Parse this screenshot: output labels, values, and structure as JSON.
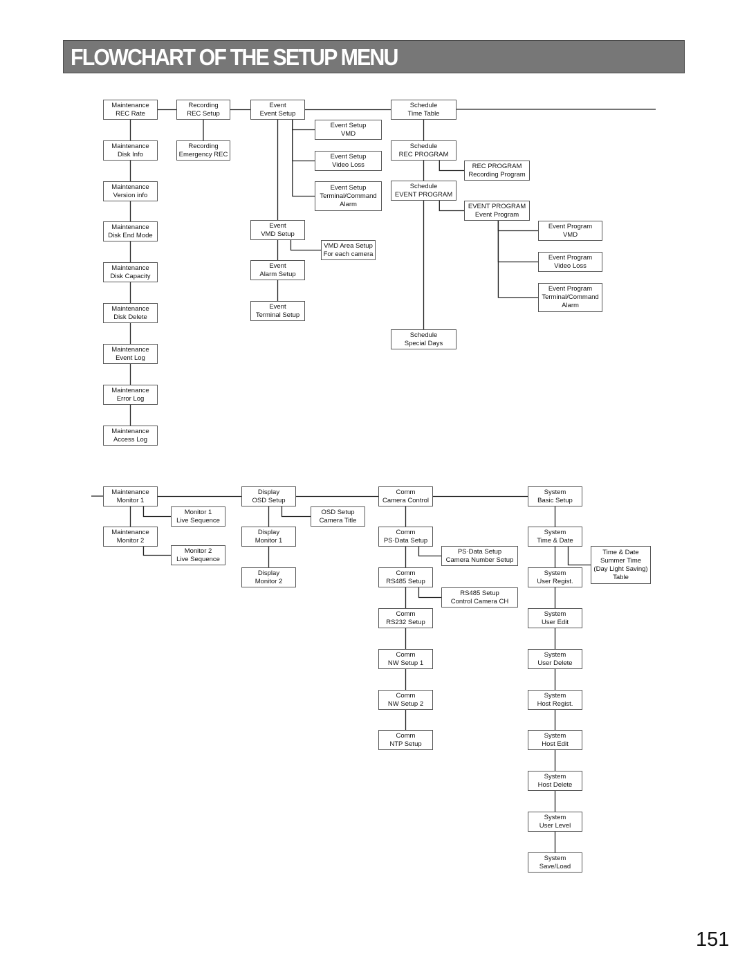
{
  "page": {
    "title": "FLOWCHART OF THE SETUP MENU",
    "page_number": "151"
  },
  "nodes": {
    "maint_rec_rate": [
      "Maintenance",
      "REC Rate"
    ],
    "maint_disk_info": [
      "Maintenance",
      "Disk Info"
    ],
    "maint_version": [
      "Maintenance",
      "Version info"
    ],
    "maint_disk_end": [
      "Maintenance",
      "Disk End Mode"
    ],
    "maint_disk_cap": [
      "Maintenance",
      "Disk Capacity"
    ],
    "maint_disk_del": [
      "Maintenance",
      "Disk Delete"
    ],
    "maint_event_log": [
      "Maintenance",
      "Event Log"
    ],
    "maint_error_log": [
      "Maintenance",
      "Error Log"
    ],
    "maint_access_log": [
      "Maintenance",
      "Access Log"
    ],
    "rec_setup": [
      "Recording",
      "REC Setup"
    ],
    "rec_emergency": [
      "Recording",
      "Emergency REC"
    ],
    "event_setup": [
      "Event",
      "Event Setup"
    ],
    "event_setup_vmd": [
      "Event Setup",
      "VMD"
    ],
    "event_setup_vloss": [
      "Event Setup",
      "Video Loss"
    ],
    "event_setup_term": [
      "Event Setup",
      "Terminal/Command",
      "Alarm"
    ],
    "event_vmd_setup": [
      "Event",
      "VMD Setup"
    ],
    "vmd_area": [
      "VMD Area Setup",
      "For each camera"
    ],
    "event_alarm": [
      "Event",
      "Alarm Setup"
    ],
    "event_terminal": [
      "Event",
      "Terminal Setup"
    ],
    "sched_time_table": [
      "Schedule",
      "Time Table"
    ],
    "sched_rec_prog": [
      "Schedule",
      "REC PROGRAM"
    ],
    "rec_prog_recording": [
      "REC PROGRAM",
      "Recording Program"
    ],
    "sched_event_prog": [
      "Schedule",
      "EVENT PROGRAM"
    ],
    "event_prog_event": [
      "EVENT PROGRAM",
      "Event Program"
    ],
    "evprog_vmd": [
      "Event Program",
      "VMD"
    ],
    "evprog_vloss": [
      "Event Program",
      "Video Loss"
    ],
    "evprog_term": [
      "Event Program",
      "Terminal/Command",
      "Alarm"
    ],
    "sched_special": [
      "Schedule",
      "Special Days"
    ],
    "maint_mon1": [
      "Maintenance",
      "Monitor 1"
    ],
    "mon1_live": [
      "Monitor 1",
      "Live Sequence"
    ],
    "maint_mon2": [
      "Maintenance",
      "Monitor 2"
    ],
    "mon2_live": [
      "Monitor 2",
      "Live Sequence"
    ],
    "disp_osd": [
      "Display",
      "OSD Setup"
    ],
    "osd_cam_title": [
      "OSD Setup",
      "Camera Title"
    ],
    "disp_mon1": [
      "Display",
      "Monitor 1"
    ],
    "disp_mon2": [
      "Display",
      "Monitor 2"
    ],
    "comm_cam_ctrl": [
      "Comm",
      "Camera Control"
    ],
    "comm_psdata": [
      "Comm",
      "PS·Data Setup"
    ],
    "psdata_cam_num": [
      "PS·Data Setup",
      "Camera Number Setup"
    ],
    "comm_rs485": [
      "Comm",
      "RS485 Setup"
    ],
    "rs485_ctrl_ch": [
      "RS485 Setup",
      "Control Camera CH"
    ],
    "comm_rs232": [
      "Comm",
      "RS232 Setup"
    ],
    "comm_nw1": [
      "Comm",
      "NW Setup 1"
    ],
    "comm_nw2": [
      "Comm",
      "NW Setup 2"
    ],
    "comm_ntp": [
      "Comm",
      "NTP Setup"
    ],
    "sys_basic": [
      "System",
      "Basic Setup"
    ],
    "sys_time_date": [
      "System",
      "Time & Date"
    ],
    "time_summer": [
      "Time & Date",
      "Summer Time",
      "(Day Light Saving)",
      "Table"
    ],
    "sys_user_regist": [
      "System",
      "User Regist."
    ],
    "sys_user_edit": [
      "System",
      "User Edit"
    ],
    "sys_user_delete": [
      "System",
      "User Delete"
    ],
    "sys_host_regist": [
      "System",
      "Host Regist."
    ],
    "sys_host_edit": [
      "System",
      "Host Edit"
    ],
    "sys_host_delete": [
      "System",
      "Host Delete"
    ],
    "sys_user_level": [
      "System",
      "User Level"
    ],
    "sys_save_load": [
      "System",
      "Save/Load"
    ]
  },
  "edges": [
    [
      "maint_rec_rate",
      "rec_setup"
    ],
    [
      "rec_setup",
      "event_setup"
    ],
    [
      "event_setup",
      "sched_time_table"
    ],
    [
      "maint_rec_rate",
      "maint_disk_info"
    ],
    [
      "maint_disk_info",
      "maint_version"
    ],
    [
      "maint_version",
      "maint_disk_end"
    ],
    [
      "maint_disk_end",
      "maint_disk_cap"
    ],
    [
      "maint_disk_cap",
      "maint_disk_del"
    ],
    [
      "maint_disk_del",
      "maint_event_log"
    ],
    [
      "maint_event_log",
      "maint_error_log"
    ],
    [
      "maint_error_log",
      "maint_access_log"
    ],
    [
      "rec_setup",
      "rec_emergency"
    ],
    [
      "event_setup",
      "event_setup_vmd"
    ],
    [
      "event_setup",
      "event_setup_vloss"
    ],
    [
      "event_setup",
      "event_setup_term"
    ],
    [
      "event_setup",
      "event_vmd_setup"
    ],
    [
      "event_vmd_setup",
      "vmd_area"
    ],
    [
      "event_vmd_setup",
      "event_alarm"
    ],
    [
      "event_alarm",
      "event_terminal"
    ],
    [
      "sched_time_table",
      "sched_rec_prog"
    ],
    [
      "sched_rec_prog",
      "rec_prog_recording"
    ],
    [
      "sched_rec_prog",
      "sched_event_prog"
    ],
    [
      "sched_event_prog",
      "event_prog_event"
    ],
    [
      "event_prog_event",
      "evprog_vmd"
    ],
    [
      "event_prog_event",
      "evprog_vloss"
    ],
    [
      "event_prog_event",
      "evprog_term"
    ],
    [
      "sched_event_prog",
      "sched_special"
    ],
    [
      "maint_mon1",
      "disp_osd"
    ],
    [
      "disp_osd",
      "comm_cam_ctrl"
    ],
    [
      "comm_cam_ctrl",
      "sys_basic"
    ],
    [
      "maint_mon1",
      "mon1_live"
    ],
    [
      "maint_mon1",
      "maint_mon2"
    ],
    [
      "maint_mon2",
      "mon2_live"
    ],
    [
      "disp_osd",
      "osd_cam_title"
    ],
    [
      "disp_osd",
      "disp_mon1"
    ],
    [
      "disp_mon1",
      "disp_mon2"
    ],
    [
      "comm_cam_ctrl",
      "comm_psdata"
    ],
    [
      "comm_psdata",
      "psdata_cam_num"
    ],
    [
      "comm_psdata",
      "comm_rs485"
    ],
    [
      "comm_rs485",
      "rs485_ctrl_ch"
    ],
    [
      "comm_rs485",
      "comm_rs232"
    ],
    [
      "comm_rs232",
      "comm_nw1"
    ],
    [
      "comm_nw1",
      "comm_nw2"
    ],
    [
      "comm_nw2",
      "comm_ntp"
    ],
    [
      "sys_basic",
      "sys_time_date"
    ],
    [
      "sys_time_date",
      "time_summer"
    ],
    [
      "sys_time_date",
      "sys_user_regist"
    ],
    [
      "sys_user_regist",
      "sys_user_edit"
    ],
    [
      "sys_user_edit",
      "sys_user_delete"
    ],
    [
      "sys_user_delete",
      "sys_host_regist"
    ],
    [
      "sys_host_regist",
      "sys_host_edit"
    ],
    [
      "sys_host_edit",
      "sys_host_delete"
    ],
    [
      "sys_host_delete",
      "sys_user_level"
    ],
    [
      "sys_user_level",
      "sys_save_load"
    ]
  ]
}
